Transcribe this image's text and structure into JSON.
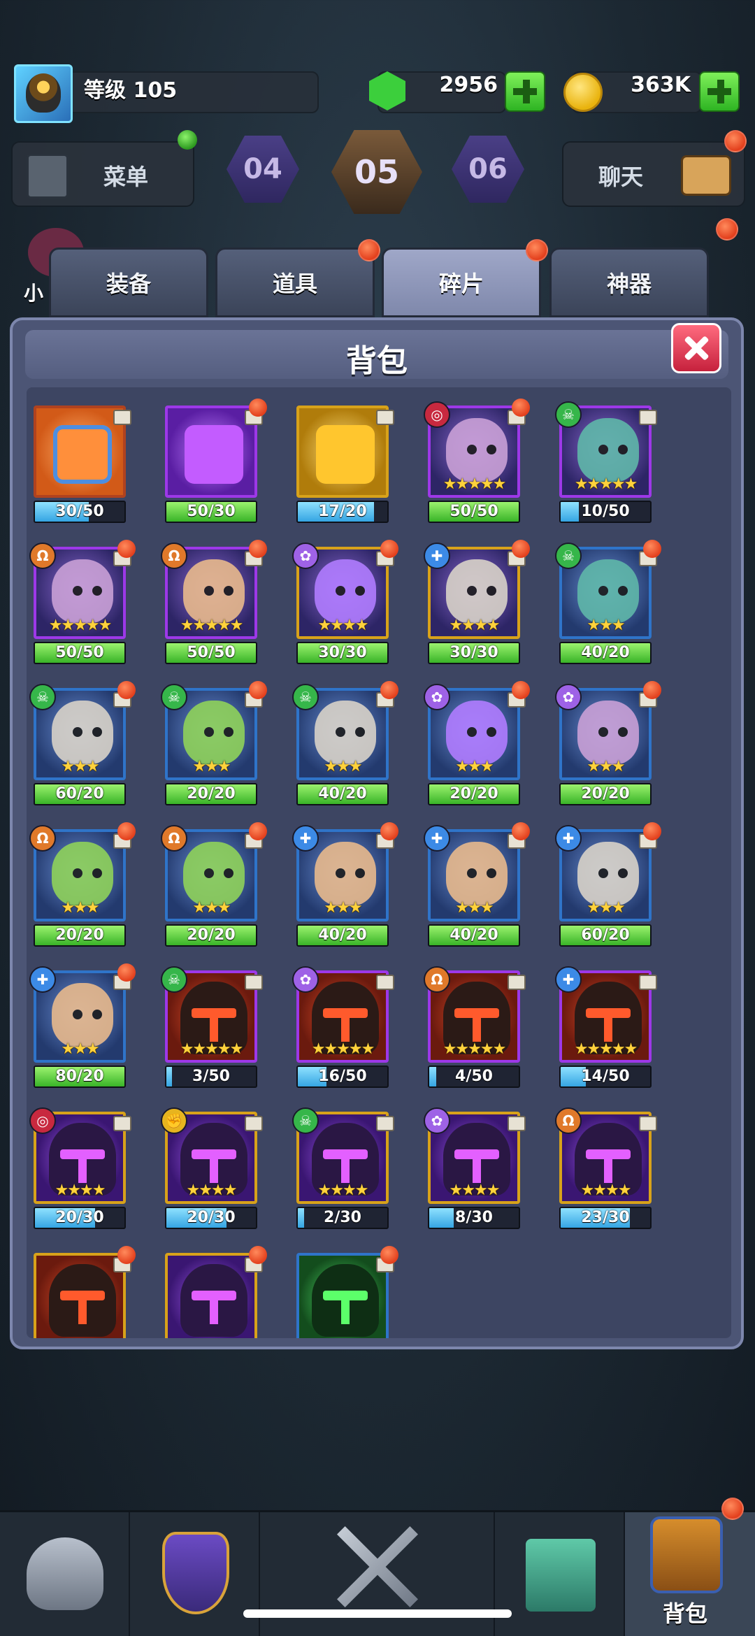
{
  "header": {
    "level_label": "等级 105",
    "gems": "2956",
    "coins": "363K"
  },
  "top_menu": {
    "menu_label": "菜单",
    "chat_label": "聊天",
    "stages": [
      "04",
      "05",
      "06"
    ],
    "partial_side_text": "小"
  },
  "tabs": [
    {
      "label": "装备",
      "active": false
    },
    {
      "label": "道具",
      "active": false
    },
    {
      "label": "碎片",
      "active": true
    },
    {
      "label": "神器",
      "active": false
    }
  ],
  "panel": {
    "title": "背包"
  },
  "items": [
    {
      "type": "piece",
      "color": "orange",
      "progress": "30/50",
      "fill": 0.6,
      "bar": "blue",
      "badge": false
    },
    {
      "type": "piece",
      "color": "purple",
      "progress": "50/30",
      "fill": 1.0,
      "bar": "green",
      "badge": true
    },
    {
      "type": "piece",
      "color": "gold",
      "progress": "17/20",
      "fill": 0.85,
      "bar": "blue",
      "badge": false
    },
    {
      "type": "hero",
      "face": "pink",
      "frame": "purple",
      "faction": "red",
      "stars": 5,
      "progress": "50/50",
      "fill": 1.0,
      "bar": "green",
      "badge": true
    },
    {
      "type": "hero",
      "face": "teal",
      "frame": "purple",
      "faction": "green",
      "stars": 5,
      "progress": "10/50",
      "fill": 0.2,
      "bar": "blue",
      "badge": false
    },
    {
      "type": "hero",
      "face": "pink",
      "frame": "purple",
      "faction": "orange",
      "stars": 5,
      "progress": "50/50",
      "fill": 1.0,
      "bar": "green",
      "badge": true
    },
    {
      "type": "hero",
      "face": "orange",
      "frame": "purple",
      "faction": "orange",
      "stars": 5,
      "progress": "50/50",
      "fill": 1.0,
      "bar": "green",
      "badge": true
    },
    {
      "type": "hero",
      "face": "violet",
      "frame": "gold",
      "faction": "purple",
      "stars": 4,
      "progress": "30/30",
      "fill": 1.0,
      "bar": "green",
      "badge": true
    },
    {
      "type": "hero",
      "face": "grey",
      "frame": "gold",
      "faction": "blue",
      "stars": 4,
      "progress": "30/30",
      "fill": 1.0,
      "bar": "green",
      "badge": true
    },
    {
      "type": "hero",
      "face": "teal",
      "frame": "blue",
      "faction": "green",
      "stars": 3,
      "progress": "40/20",
      "fill": 1.0,
      "bar": "green",
      "badge": true
    },
    {
      "type": "hero",
      "face": "grey",
      "frame": "blue",
      "faction": "green",
      "stars": 3,
      "progress": "60/20",
      "fill": 1.0,
      "bar": "green",
      "badge": true
    },
    {
      "type": "hero",
      "face": "green",
      "frame": "blue",
      "faction": "green",
      "stars": 3,
      "progress": "20/20",
      "fill": 1.0,
      "bar": "green",
      "badge": true
    },
    {
      "type": "hero",
      "face": "grey",
      "frame": "blue",
      "faction": "green",
      "stars": 3,
      "progress": "40/20",
      "fill": 1.0,
      "bar": "green",
      "badge": true
    },
    {
      "type": "hero",
      "face": "violet",
      "frame": "blue",
      "faction": "purple",
      "stars": 3,
      "progress": "20/20",
      "fill": 1.0,
      "bar": "green",
      "badge": true
    },
    {
      "type": "hero",
      "face": "pink",
      "frame": "blue",
      "faction": "purple",
      "stars": 3,
      "progress": "20/20",
      "fill": 1.0,
      "bar": "green",
      "badge": true
    },
    {
      "type": "hero",
      "face": "green",
      "frame": "blue",
      "faction": "orange",
      "stars": 3,
      "progress": "20/20",
      "fill": 1.0,
      "bar": "green",
      "badge": true
    },
    {
      "type": "hero",
      "face": "green",
      "frame": "blue",
      "faction": "orange",
      "stars": 3,
      "progress": "20/20",
      "fill": 1.0,
      "bar": "green",
      "badge": true
    },
    {
      "type": "hero",
      "face": "orange",
      "frame": "blue",
      "faction": "blue",
      "stars": 3,
      "progress": "40/20",
      "fill": 1.0,
      "bar": "green",
      "badge": true
    },
    {
      "type": "hero",
      "face": "orange",
      "frame": "blue",
      "faction": "blue",
      "stars": 3,
      "progress": "40/20",
      "fill": 1.0,
      "bar": "green",
      "badge": true
    },
    {
      "type": "hero",
      "face": "grey",
      "frame": "blue",
      "faction": "blue",
      "stars": 3,
      "progress": "60/20",
      "fill": 1.0,
      "bar": "green",
      "badge": true
    },
    {
      "type": "hero",
      "face": "orange",
      "frame": "blue",
      "faction": "blue",
      "stars": 3,
      "progress": "80/20",
      "fill": 1.0,
      "bar": "green",
      "badge": true
    },
    {
      "type": "helmet",
      "color": "red",
      "frame": "purple",
      "faction": "green",
      "stars": 5,
      "progress": "3/50",
      "fill": 0.06,
      "bar": "blue",
      "badge": false
    },
    {
      "type": "helmet",
      "color": "red",
      "frame": "purple",
      "faction": "purple",
      "stars": 5,
      "progress": "16/50",
      "fill": 0.32,
      "bar": "blue",
      "badge": false
    },
    {
      "type": "helmet",
      "color": "red",
      "frame": "purple",
      "faction": "orange",
      "stars": 5,
      "progress": "4/50",
      "fill": 0.08,
      "bar": "blue",
      "badge": false
    },
    {
      "type": "helmet",
      "color": "red",
      "frame": "purple",
      "faction": "blue",
      "stars": 5,
      "progress": "14/50",
      "fill": 0.28,
      "bar": "blue",
      "badge": false
    },
    {
      "type": "helmet",
      "color": "purple",
      "frame": "gold",
      "faction": "red",
      "stars": 4,
      "progress": "20/30",
      "fill": 0.67,
      "bar": "blue",
      "badge": false
    },
    {
      "type": "helmet",
      "color": "purple",
      "frame": "gold",
      "faction": "yellow",
      "stars": 4,
      "progress": "20/30",
      "fill": 0.67,
      "bar": "blue",
      "badge": false
    },
    {
      "type": "helmet",
      "color": "purple",
      "frame": "gold",
      "faction": "green",
      "stars": 4,
      "progress": "2/30",
      "fill": 0.07,
      "bar": "blue",
      "badge": false
    },
    {
      "type": "helmet",
      "color": "purple",
      "frame": "gold",
      "faction": "purple",
      "stars": 4,
      "progress": "8/30",
      "fill": 0.27,
      "bar": "blue",
      "badge": false
    },
    {
      "type": "helmet",
      "color": "purple",
      "frame": "gold",
      "faction": "orange",
      "stars": 4,
      "progress": "23/30",
      "fill": 0.77,
      "bar": "blue",
      "badge": false
    },
    {
      "type": "helmet",
      "color": "red",
      "frame": "gold",
      "faction": "",
      "stars": 0,
      "progress": "",
      "fill": 0,
      "bar": "blue",
      "badge": true
    },
    {
      "type": "helmet",
      "color": "purple",
      "frame": "gold",
      "faction": "",
      "stars": 0,
      "progress": "",
      "fill": 0,
      "bar": "blue",
      "badge": true
    },
    {
      "type": "helmet",
      "color": "green",
      "frame": "blue",
      "faction": "",
      "stars": 0,
      "progress": "",
      "fill": 0,
      "bar": "blue",
      "badge": true
    }
  ],
  "bottom_nav": {
    "items": [
      "heroes-icon",
      "guild-icon",
      "battle-icon",
      "castle-icon",
      "backpack-icon"
    ],
    "active_label": "背包"
  }
}
